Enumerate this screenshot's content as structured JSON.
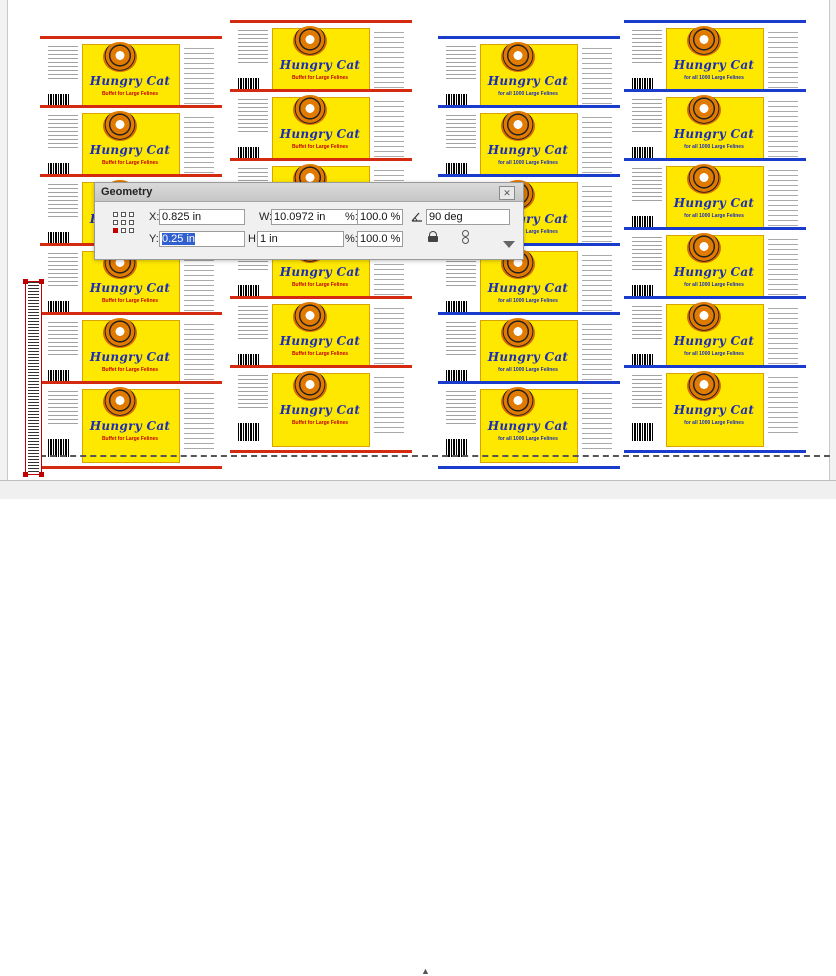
{
  "labels": {
    "brand_text": "Hungry Cat",
    "tag_red": "Buffet for Large Felines",
    "tag_blue": "for all 1000 Large Felines"
  },
  "geometry_dialog": {
    "title": "Geometry",
    "x_label": "X:",
    "x_value": "0.825 in",
    "y_label": "Y:",
    "y_value": "0.25 in",
    "w_label": "W:",
    "w_value": "10.0972 in",
    "h_label": "H:",
    "h_value": "1 in",
    "scale_label": "%:",
    "scale_x": "100.0 %",
    "scale_y": "100.0 %",
    "angle_value": "90 deg"
  },
  "colors": {
    "red_stripe": "#d42a10",
    "blue_stripe": "#1a3ccc",
    "label_yellow": "#ffe800"
  }
}
